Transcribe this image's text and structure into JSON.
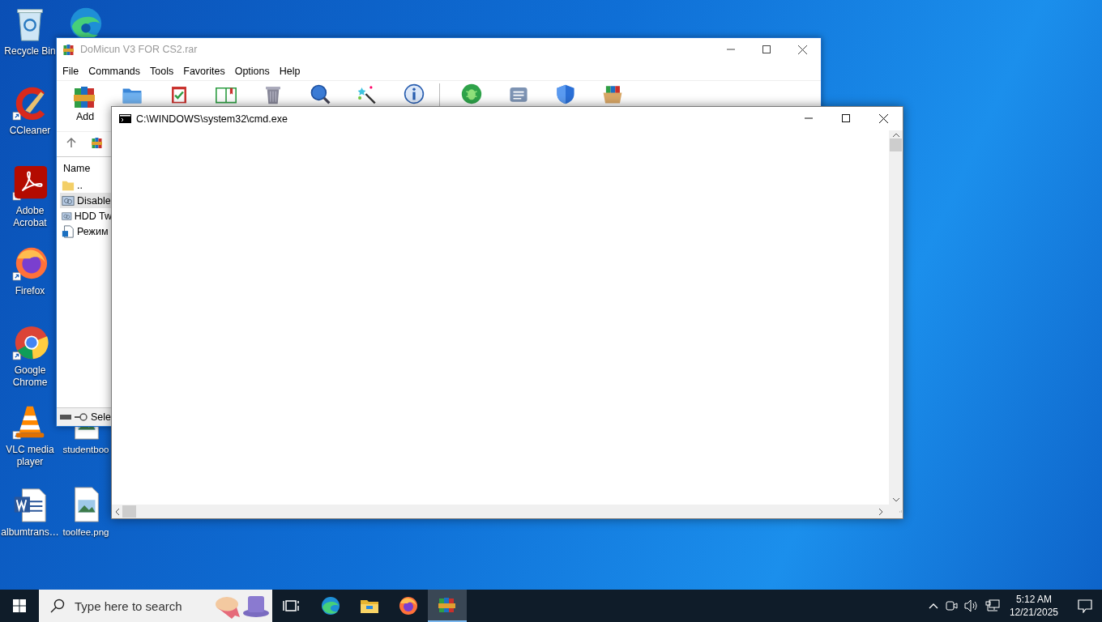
{
  "desktop": {
    "icons": [
      {
        "kind": "recycle",
        "label": "Recycle Bin"
      },
      {
        "kind": "edge"
      },
      {
        "kind": "ccleaner",
        "label": "CCleaner"
      },
      {
        "kind": "acrobat",
        "label": "Adobe Acrobat"
      },
      {
        "kind": "firefox",
        "label": "Firefox"
      },
      {
        "kind": "chrome",
        "label": "Google Chrome"
      },
      {
        "kind": "vlc",
        "label": "VLC media player"
      },
      {
        "kind": "image",
        "label": "studentboo"
      },
      {
        "kind": "word",
        "label": "albumtrans…"
      },
      {
        "kind": "image",
        "label": "toolfee.png"
      }
    ]
  },
  "winrar": {
    "title": "DoMicun V3 FOR CS2.rar",
    "menu": [
      "File",
      "Commands",
      "Tools",
      "Favorites",
      "Options",
      "Help"
    ],
    "toolbar": [
      {
        "kind": "add",
        "label": "Add"
      },
      {
        "kind": "extract"
      },
      {
        "kind": "test"
      },
      {
        "kind": "view"
      },
      {
        "kind": "delete"
      },
      {
        "kind": "find"
      },
      {
        "kind": "wizard"
      },
      {
        "kind": "info"
      },
      {
        "kind": "separator"
      },
      {
        "kind": "virus"
      },
      {
        "kind": "comment"
      },
      {
        "kind": "protect"
      },
      {
        "kind": "sfx"
      }
    ],
    "columns": [
      "Name"
    ],
    "rows": [
      {
        "kind": "folder",
        "name": "..",
        "selected": false
      },
      {
        "kind": "registry",
        "name": "Disable",
        "selected": true
      },
      {
        "kind": "registry",
        "name": "HDD Tw",
        "selected": false
      },
      {
        "kind": "script",
        "name": "Режим",
        "selected": false
      }
    ],
    "status": "Sele"
  },
  "cmd": {
    "title": "C:\\WINDOWS\\system32\\cmd.exe"
  },
  "taskbar": {
    "search": {
      "placeholder": "Type here to search"
    },
    "apps": [
      {
        "kind": "taskview",
        "selected": false
      },
      {
        "kind": "edge",
        "selected": false
      },
      {
        "kind": "explorer",
        "selected": false
      },
      {
        "kind": "firefox",
        "selected": false
      },
      {
        "kind": "winrar",
        "selected": true
      }
    ],
    "clock": {
      "time": "5:12 AM",
      "date": "12/21/2025"
    }
  }
}
